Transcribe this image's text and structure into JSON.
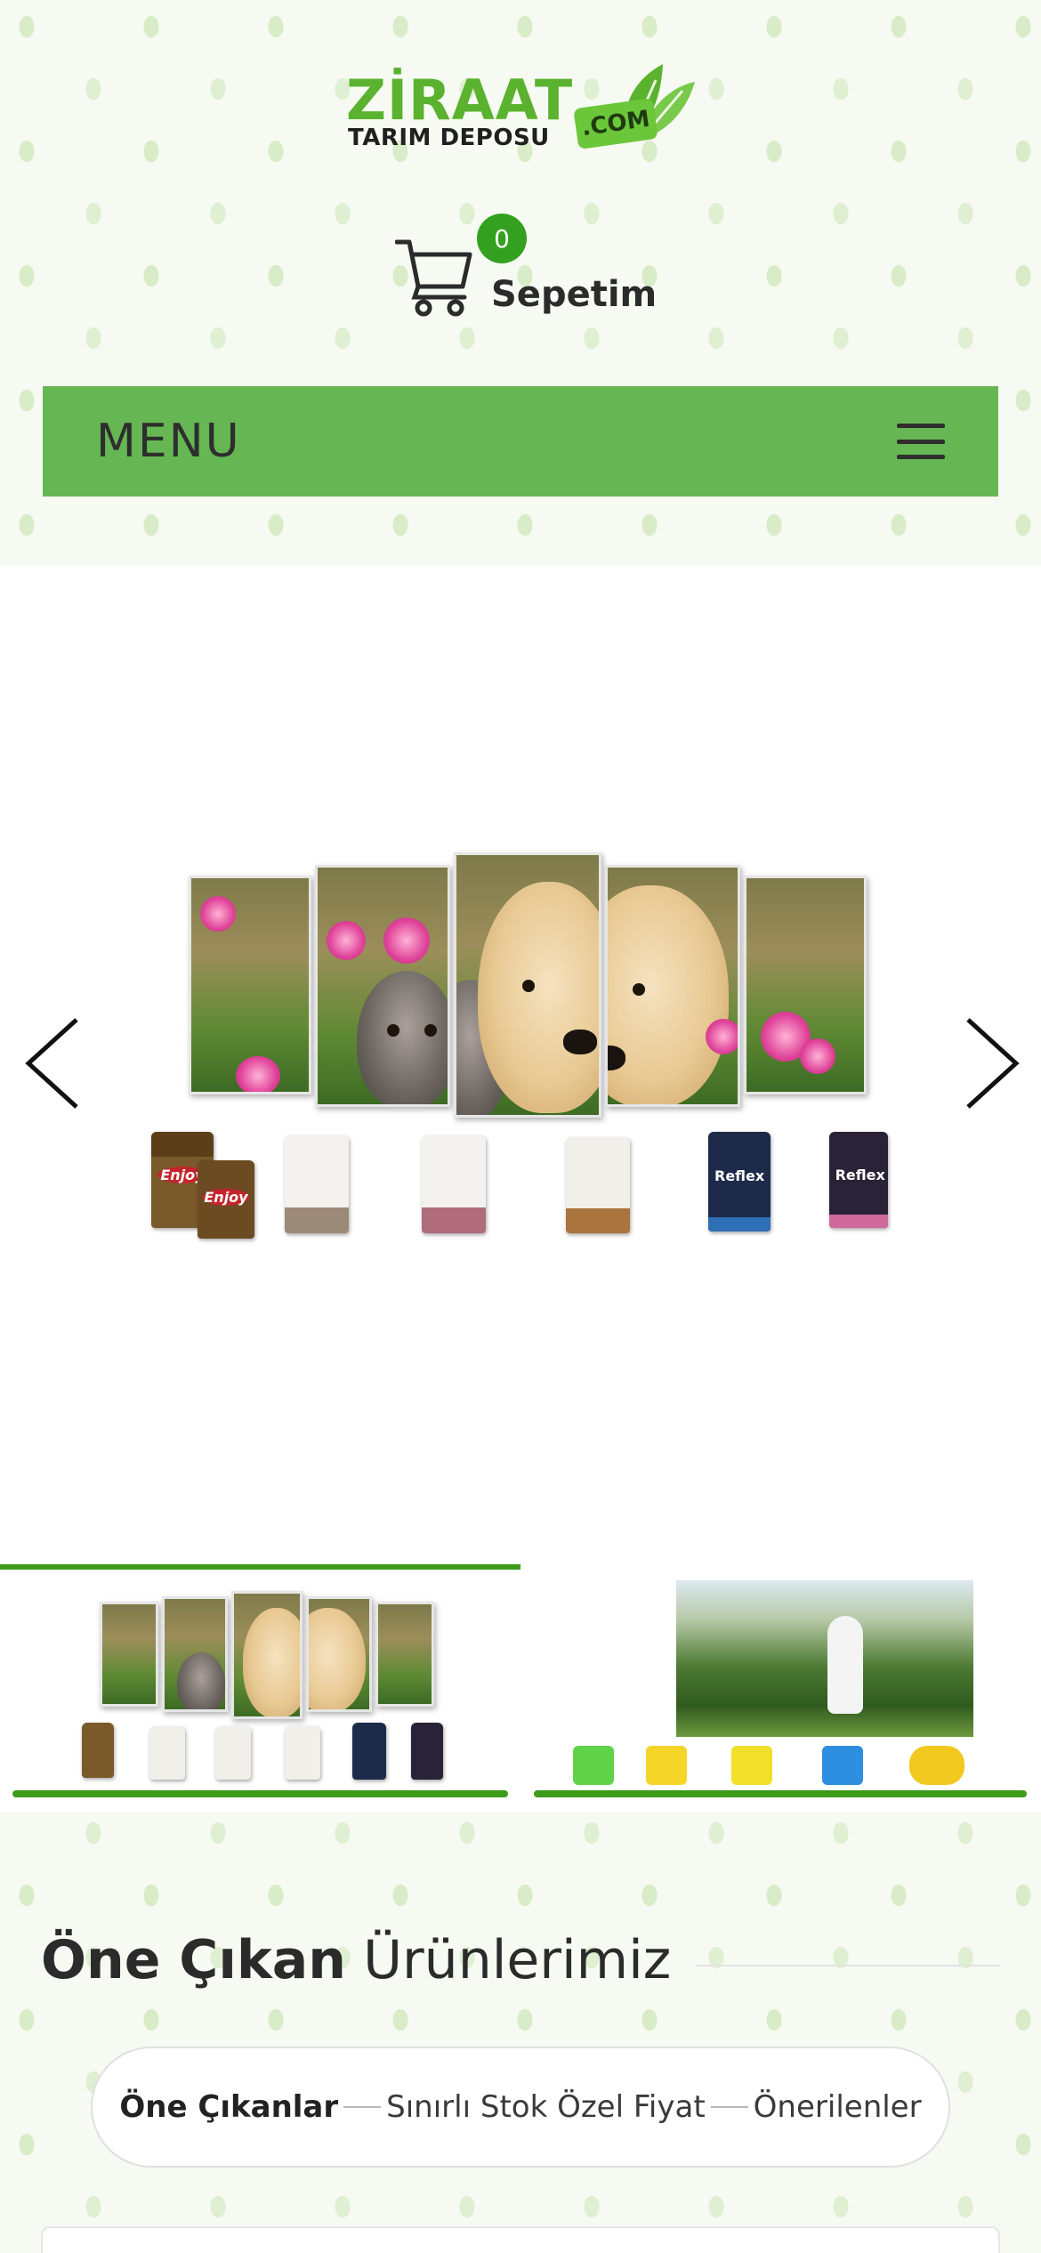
{
  "header": {
    "logo": {
      "word": "ZİRAAT",
      "sub": "TARIM DEPOSU",
      "badge": ".COM"
    },
    "cart": {
      "count": "0",
      "label": "Sepetim"
    },
    "menu": {
      "label": "MENU"
    }
  },
  "slider": {
    "slides": [
      {
        "name": "Pet food banner (kitten & puppy, Enjoy and Reflex food bags)"
      },
      {
        "name": "Garden sprayer banner"
      }
    ],
    "active_index": 0,
    "bag_labels": [
      "Enjoy",
      "Enjoy",
      "Reflex",
      "Reflex"
    ]
  },
  "featured": {
    "title_bold": "Öne Çıkan",
    "title_rest": " Ürünlerimiz",
    "tabs": [
      {
        "label": "Öne Çıkanlar",
        "active": true
      },
      {
        "label": "Sınırlı Stok Özel Fiyat",
        "active": false
      },
      {
        "label": "Önerilenler",
        "active": false
      }
    ]
  },
  "colors": {
    "brand_green": "#66b753",
    "accent_green": "#3d9a1a",
    "badge_green": "#33a01f"
  }
}
